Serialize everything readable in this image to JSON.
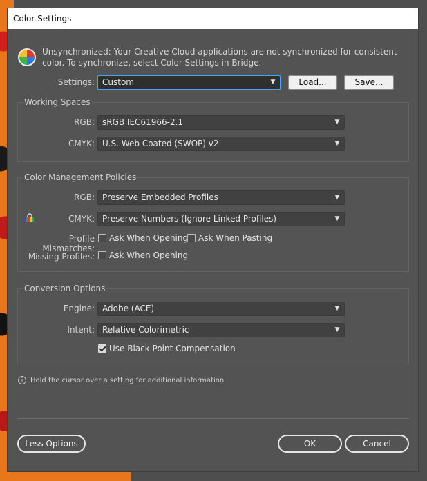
{
  "window": {
    "title": "Color Settings"
  },
  "sync": {
    "message": "Unsynchronized: Your Creative Cloud applications are not synchronized for consistent color. To synchronize, select Color Settings in Bridge."
  },
  "settings": {
    "label": "Settings:",
    "value": "Custom",
    "load_label": "Load...",
    "save_label": "Save..."
  },
  "working_spaces": {
    "title": "Working Spaces",
    "rgb_label": "RGB:",
    "rgb_value": "sRGB IEC61966-2.1",
    "cmyk_label": "CMYK:",
    "cmyk_value": "U.S. Web Coated (SWOP) v2"
  },
  "policies": {
    "title": "Color Management Policies",
    "rgb_label": "RGB:",
    "rgb_value": "Preserve Embedded Profiles",
    "cmyk_label": "CMYK:",
    "cmyk_value": "Preserve Numbers (Ignore Linked Profiles)",
    "mismatch_label": "Profile Mismatches:",
    "ask_opening_label": "Ask When Opening",
    "ask_pasting_label": "Ask When Pasting",
    "missing_label": "Missing Profiles:",
    "missing_ask_opening_label": "Ask When Opening",
    "checks": {
      "mismatch_opening": false,
      "mismatch_pasting": false,
      "missing_opening": false
    }
  },
  "conversion": {
    "title": "Conversion Options",
    "engine_label": "Engine:",
    "engine_value": "Adobe (ACE)",
    "intent_label": "Intent:",
    "intent_value": "Relative Colorimetric",
    "bpc_label": "Use Black Point Compensation",
    "bpc_checked": true
  },
  "hint": {
    "text": "Hold the cursor over a setting for additional information."
  },
  "footer": {
    "less_options_label": "Less Options",
    "ok_label": "OK",
    "cancel_label": "Cancel"
  },
  "icons": {
    "app_logo": "color-wheel-icon",
    "lock": "lock-icon",
    "info": "info-icon",
    "dropdown": "chevron-down-icon"
  }
}
